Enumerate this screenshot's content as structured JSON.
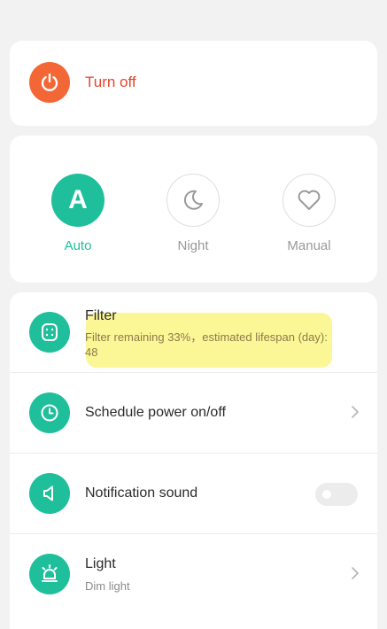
{
  "power": {
    "label": "Turn off",
    "icon": "power-icon",
    "color": "#f36636"
  },
  "modes": [
    {
      "label": "Auto",
      "letter": "A",
      "active": true
    },
    {
      "label": "Night",
      "icon": "moon-icon",
      "active": false
    },
    {
      "label": "Manual",
      "icon": "heart-icon",
      "active": false
    }
  ],
  "settings": {
    "filter": {
      "title": "Filter",
      "subtitle": "Filter remaining 33%，estimated lifespan (day): 48",
      "icon": "filter-icon"
    },
    "schedule": {
      "title": "Schedule power on/off",
      "icon": "clock-icon"
    },
    "notification": {
      "title": "Notification sound",
      "icon": "speaker-icon",
      "enabled": false
    },
    "light": {
      "title": "Light",
      "subtitle": "Dim light",
      "icon": "lamp-icon"
    }
  },
  "colors": {
    "accent": "#1fbf9c",
    "power_accent": "#f36636",
    "power_text": "#e8442c"
  }
}
